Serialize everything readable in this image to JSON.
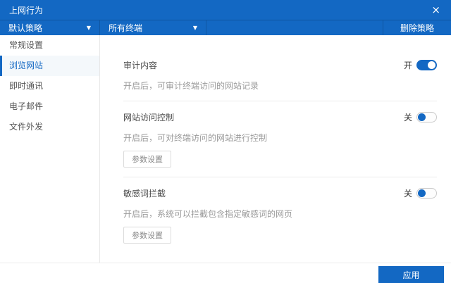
{
  "window": {
    "title": "上网行为",
    "close_icon": "×"
  },
  "toolbar": {
    "policy_dropdown": {
      "label": "默认策略",
      "caret_icon": "▼"
    },
    "terminal_dropdown": {
      "label": "所有终端",
      "caret_icon": "▼"
    },
    "delete_button_label": "删除策略"
  },
  "sidebar": {
    "items": [
      {
        "label": "常规设置",
        "selected": false
      },
      {
        "label": "浏览网站",
        "selected": true
      },
      {
        "label": "即时通讯",
        "selected": false
      },
      {
        "label": "电子邮件",
        "selected": false
      },
      {
        "label": "文件外发",
        "selected": false
      }
    ]
  },
  "main": {
    "sections": [
      {
        "title": "审计内容",
        "toggle_state_label": "开",
        "toggle_on": true,
        "description": "开启后，可审计终端访问的网站记录"
      },
      {
        "title": "网站访问控制",
        "toggle_state_label": "关",
        "toggle_on": false,
        "description": "开启后，可对终端访问的网站进行控制",
        "param_button_label": "参数设置"
      },
      {
        "title": "敏感词拦截",
        "toggle_state_label": "关",
        "toggle_on": false,
        "description": "开启后，系统可以拦截包含指定敏感词的网页",
        "param_button_label": "参数设置"
      }
    ]
  },
  "footer": {
    "apply_label": "应用"
  },
  "colors": {
    "primary_blue": "#1368c3",
    "sidebar_selected_bg": "#f4f8fb",
    "divider": "#ececec",
    "description_text": "#9a9a9a",
    "toggle_off_border": "#c9c9c9"
  }
}
